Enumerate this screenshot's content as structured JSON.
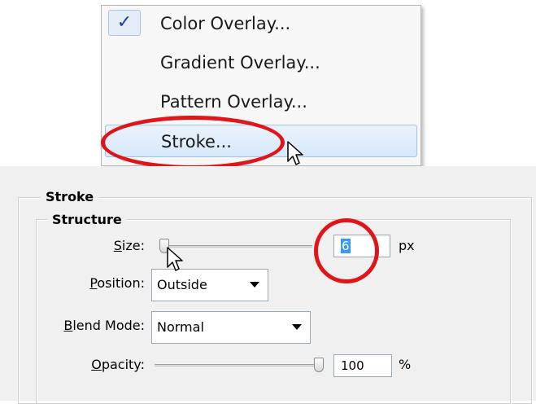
{
  "menu": {
    "items": [
      {
        "label": "Color Overlay...",
        "checked": true
      },
      {
        "label": "Gradient Overlay...",
        "checked": false
      },
      {
        "label": "Pattern Overlay...",
        "checked": false
      },
      {
        "label": "Stroke...",
        "checked": false,
        "highlighted": true
      }
    ],
    "check_glyph": "✓"
  },
  "stroke": {
    "title": "Stroke",
    "structure": {
      "title": "Structure",
      "size": {
        "label_key": "S",
        "label_rest": "ize:",
        "value": "6",
        "unit": "px",
        "slider_fraction": 0.0
      },
      "position": {
        "label_key": "P",
        "label_rest": "osition:",
        "value": "Outside"
      },
      "blend_mode": {
        "label_key": "B",
        "label_rest": "lend Mode:",
        "value": "Normal"
      },
      "opacity": {
        "label_key": "O",
        "label_rest": "pacity:",
        "value": "100",
        "unit": "%",
        "slider_fraction": 1.0
      }
    }
  },
  "annotations": {
    "highlight_color": "#e0151a"
  },
  "icons": {
    "cursor": "arrow-cursor-icon",
    "dropdown": "chevron-down-icon"
  }
}
